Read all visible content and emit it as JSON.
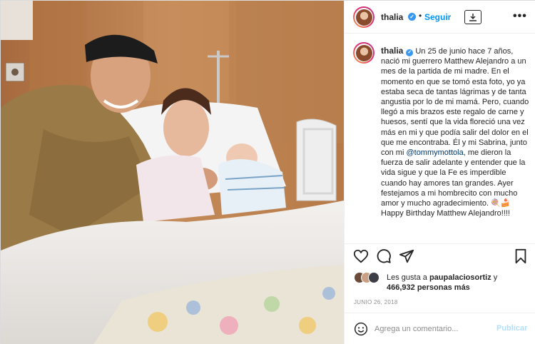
{
  "photo": {
    "alt_subject": "photo"
  },
  "header": {
    "username": "thalia",
    "separator": "•",
    "follow_label": "Seguir",
    "more_label": "•••"
  },
  "caption": {
    "username": "thalia",
    "text_before_mention": "Un 25 de junio hace 7 años, nació mi guerrero Matthew Alejandro a un mes de la partida de mi madre. En el momento en que se tomó esta foto, yo ya estaba seca de tantas lágrimas y de tanta angustia por lo de mi mamá. Pero, cuando llegó a mis brazos este regalo de carne y huesos, sentí que la vida floreció una vez más en mi y que podía salir del dolor en el que me encontraba. Él y mi Sabrina, junto con mi ",
    "mention": "@tommymottola",
    "text_after_mention": ", me dieron la fuerza de salir adelante y entender que la vida sigue y que la Fe es imperdible cuando hay amores tan grandes. Ayer festejamos a mi hombrecito con mucho amor y mucho agradecimiento. 🍭🍰 Happy Birthday Matthew Alejandro!!!!"
  },
  "actions": {
    "like_icon": "heart-icon",
    "comment_icon": "comment-icon",
    "share_icon": "paper-plane-icon",
    "save_icon": "bookmark-icon"
  },
  "likes": {
    "prefix": "Les gusta a ",
    "liker": "paupalaciosortiz",
    "suffix": " y",
    "count_text": "466,932 personas más"
  },
  "date": "JUNIO 26, 2018",
  "comment": {
    "placeholder": "Agrega un comentario...",
    "publish_label": "Publicar"
  },
  "colors": {
    "accent": "#0095f6",
    "publish_disabled": "#b2dffc",
    "mention": "#00376b",
    "verified": "#3897f0"
  }
}
